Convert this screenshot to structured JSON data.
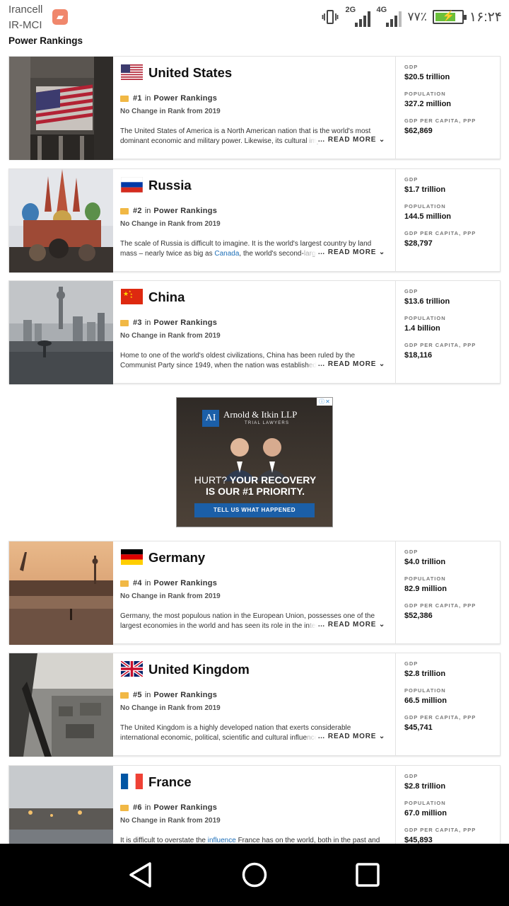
{
  "status_bar": {
    "carrier_1": "Irancell",
    "carrier_2": "IR-MCI",
    "net_1": "2G",
    "net_2": "4G",
    "battery_pct": "۷۷٪",
    "time": "۱۶:۲۴"
  },
  "page_title": "Power Rankings",
  "labels": {
    "in": "in",
    "rankings": "Power Rankings",
    "read_more": "READ MORE ⌄",
    "gdp": "GDP",
    "population": "POPULATION",
    "gdp_ppp": "GDP PER CAPITA, PPP"
  },
  "countries": [
    {
      "name": "United States",
      "rank": "#1",
      "change": "No Change in Rank from 2019",
      "desc_a": "The United States of America is a North American nation that is the world's most dominant economic and military power. Likewise, its cultural",
      "desc_link": "",
      "desc_b": "",
      "desc_fade": " imprint",
      "gdp": "$20.5 trillion",
      "population": "327.2 million",
      "gdp_ppp": "$62,869"
    },
    {
      "name": "Russia",
      "rank": "#2",
      "change": "No Change in Rank from 2019",
      "desc_a": "The scale of Russia is difficult to imagine. It is the world's largest country by land mass – nearly twice as big as ",
      "desc_link": "Canada",
      "desc_b": ", the world's second-",
      "desc_fade": "largest",
      "gdp": "$1.7 trillion",
      "population": "144.5 million",
      "gdp_ppp": "$28,797"
    },
    {
      "name": "China",
      "rank": "#3",
      "change": "No Change in Rank from 2019",
      "desc_a": "Home to one of the world's oldest civilizations, China has been ruled by the Communist Party since 1949, when the nation was establish",
      "desc_link": "",
      "desc_b": "",
      "desc_fade": "ed",
      "gdp": "$13.6 trillion",
      "population": "1.4 billion",
      "gdp_ppp": "$18,116"
    },
    {
      "name": "Germany",
      "rank": "#4",
      "change": "No Change in Rank from 2019",
      "desc_a": "Germany, the most populous nation in the European Union, possesses one of the largest economies in the world and has seen its role in the in",
      "desc_link": "",
      "desc_b": "",
      "desc_fade": "ternational",
      "gdp": "$4.0 trillion",
      "population": "82.9 million",
      "gdp_ppp": "$52,386"
    },
    {
      "name": "United Kingdom",
      "rank": "#5",
      "change": "No Change in Rank from 2019",
      "desc_a": "The United Kingdom is a highly developed nation that exerts considerable international economic, political, scientific and cultural influe",
      "desc_link": "",
      "desc_b": "",
      "desc_fade": "nce",
      "gdp": "$2.8 trillion",
      "population": "66.5 million",
      "gdp_ppp": "$45,741"
    },
    {
      "name": "France",
      "rank": "#6",
      "change": "No Change in Rank from 2019",
      "desc_a": "It is difficult to overstate the ",
      "desc_link": "influence",
      "desc_b": " France has on the world, both in the past and",
      "desc_fade": "",
      "gdp": "$2.8 trillion",
      "population": "67.0 million",
      "gdp_ppp": "$45,893"
    }
  ],
  "ad": {
    "logo": "AI",
    "firm": "Arnold & Itkin LLP",
    "firm_sub": "TRIAL LAWYERS",
    "headline_a": "HURT?",
    "headline_b": " YOUR RECOVERY",
    "headline_c": "IS OUR #1 PRIORITY.",
    "cta": "TELL US WHAT HAPPENED"
  },
  "colors": {
    "accent_link": "#1e6fb8",
    "rank_badge": "#f1b845",
    "ad_cta": "#1b5fa8"
  }
}
